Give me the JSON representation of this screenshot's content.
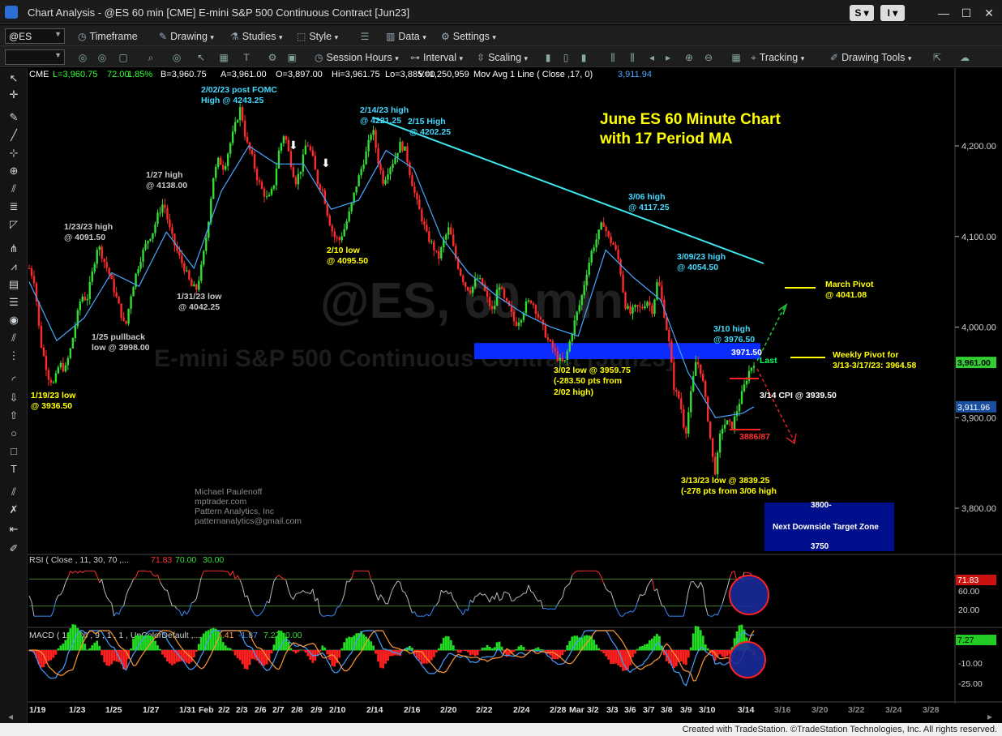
{
  "window": {
    "title": "Chart Analysis - @ES 60 min [CME] E-mini S&P 500 Continuous Contract [Jun23]",
    "btn_s": "S ▾",
    "btn_i": "I ▾",
    "minimize": "—",
    "maximize": "☐",
    "close": "✕"
  },
  "toolbar1": {
    "symbol": "@ES",
    "timeframe": "Timeframe",
    "drawing": "Drawing",
    "studies": "Studies",
    "style": "Style",
    "data": "Data",
    "settings": "Settings"
  },
  "toolbar2": {
    "session_hours": "Session Hours",
    "interval": "Interval",
    "scaling": "Scaling",
    "tracking": "Tracking",
    "drawing_tools": "Drawing Tools"
  },
  "status_bar": "Created with TradeStation. ©TradeStation Technologies, Inc. All rights reserved.",
  "chart_data": {
    "type": "line",
    "symbol_line": {
      "exchange": "CME",
      "last": "L=3,960.75",
      "net": "72.00",
      "pct": "1.85%",
      "bid": "B=3,960.75",
      "ask": "A=3,961.00",
      "open": "O=3,897.00",
      "high": "Hi=3,961.75",
      "low": "Lo=3,885.00",
      "volume": "V=1,250,959",
      "ma_label": "Mov Avg 1 Line ( Close ,17, 0)",
      "ma_value": "3,911.94"
    },
    "title": "June ES 60 Minute Chart",
    "subtitle": "with 17 Period MA",
    "watermark_symbol": "@ES, 60 min",
    "watermark_name": "E-mini S&P 500 Continuous Contract [Jun23]",
    "author_lines": [
      "Michael Paulenoff",
      "mptrader.com",
      "Pattern Analytics, Inc",
      "patternanalytics@gmail.com"
    ],
    "y_ticks": [
      "4,200.00",
      "4,100.00",
      "4,000.00",
      "3,900.00",
      "3,800.00"
    ],
    "y_tick_values": [
      4200,
      4100,
      4000,
      3900,
      3800
    ],
    "ylim": [
      3735,
      4270
    ],
    "x_ticks": [
      "1/19",
      "1/23",
      "1/25",
      "1/27",
      "1/31",
      "Feb",
      "2/2",
      "2/3",
      "2/6",
      "2/7",
      "2/8",
      "2/9",
      "2/10",
      "2/14",
      "2/16",
      "2/20",
      "2/22",
      "2/24",
      "2/28",
      "Mar",
      "3/2",
      "3/3",
      "3/6",
      "3/7",
      "3/8",
      "3/9",
      "3/10",
      "3/14",
      "3/16",
      "3/20",
      "3/22",
      "3/24",
      "3/28"
    ],
    "price_path": [
      [
        0,
        4065
      ],
      [
        2,
        4050
      ],
      [
        4,
        3985
      ],
      [
        7,
        3945
      ],
      [
        9,
        3937
      ],
      [
        11,
        3960
      ],
      [
        13,
        3952
      ],
      [
        15,
        3975
      ],
      [
        17,
        4005
      ],
      [
        19,
        4035
      ],
      [
        21,
        4030
      ],
      [
        23,
        4060
      ],
      [
        25,
        4092
      ],
      [
        27,
        4075
      ],
      [
        29,
        4060
      ],
      [
        31,
        4040
      ],
      [
        33,
        4020
      ],
      [
        35,
        3998
      ],
      [
        37,
        4035
      ],
      [
        39,
        4060
      ],
      [
        41,
        4080
      ],
      [
        43,
        4095
      ],
      [
        45,
        4105
      ],
      [
        47,
        4125
      ],
      [
        49,
        4138
      ],
      [
        51,
        4110
      ],
      [
        53,
        4090
      ],
      [
        55,
        4075
      ],
      [
        57,
        4062
      ],
      [
        59,
        4045
      ],
      [
        61,
        4042
      ],
      [
        63,
        4070
      ],
      [
        65,
        4110
      ],
      [
        67,
        4165
      ],
      [
        69,
        4185
      ],
      [
        71,
        4175
      ],
      [
        73,
        4200
      ],
      [
        75,
        4222
      ],
      [
        77,
        4243
      ],
      [
        79,
        4205
      ],
      [
        81,
        4190
      ],
      [
        83,
        4165
      ],
      [
        85,
        4150
      ],
      [
        87,
        4140
      ],
      [
        89,
        4155
      ],
      [
        91,
        4195
      ],
      [
        93,
        4215
      ],
      [
        95,
        4185
      ],
      [
        97,
        4160
      ],
      [
        99,
        4175
      ],
      [
        101,
        4205
      ],
      [
        103,
        4190
      ],
      [
        105,
        4160
      ],
      [
        107,
        4150
      ],
      [
        109,
        4120
      ],
      [
        111,
        4100
      ],
      [
        113,
        4096
      ],
      [
        115,
        4110
      ],
      [
        117,
        4130
      ],
      [
        119,
        4155
      ],
      [
        121,
        4175
      ],
      [
        123,
        4195
      ],
      [
        125,
        4221
      ],
      [
        127,
        4185
      ],
      [
        129,
        4160
      ],
      [
        131,
        4175
      ],
      [
        133,
        4185
      ],
      [
        135,
        4202
      ],
      [
        137,
        4195
      ],
      [
        139,
        4165
      ],
      [
        141,
        4140
      ],
      [
        143,
        4120
      ],
      [
        145,
        4100
      ],
      [
        147,
        4090
      ],
      [
        149,
        4075
      ],
      [
        151,
        4095
      ],
      [
        153,
        4110
      ],
      [
        155,
        4080
      ],
      [
        157,
        4060
      ],
      [
        159,
        4045
      ],
      [
        161,
        4040
      ],
      [
        163,
        4055
      ],
      [
        165,
        4048
      ],
      [
        167,
        4030
      ],
      [
        169,
        4015
      ],
      [
        171,
        4050
      ],
      [
        173,
        4030
      ],
      [
        175,
        4020
      ],
      [
        177,
        4003
      ],
      [
        179,
        4010
      ],
      [
        181,
        4025
      ],
      [
        183,
        4030
      ],
      [
        185,
        4015
      ],
      [
        187,
        4000
      ],
      [
        189,
        3985
      ],
      [
        191,
        3975
      ],
      [
        193,
        3963
      ],
      [
        195,
        3960
      ],
      [
        197,
        3985
      ],
      [
        199,
        4010
      ],
      [
        201,
        4030
      ],
      [
        203,
        4060
      ],
      [
        205,
        4085
      ],
      [
        207,
        4100
      ],
      [
        209,
        4117
      ],
      [
        211,
        4098
      ],
      [
        213,
        4090
      ],
      [
        215,
        4070
      ],
      [
        217,
        4025
      ],
      [
        219,
        4015
      ],
      [
        221,
        4022
      ],
      [
        223,
        4020
      ],
      [
        225,
        4030
      ],
      [
        227,
        4018
      ],
      [
        229,
        4054
      ],
      [
        231,
        4020
      ],
      [
        233,
        3985
      ],
      [
        235,
        3930
      ],
      [
        237,
        3920
      ],
      [
        239,
        3880
      ],
      [
        241,
        3925
      ],
      [
        243,
        3965
      ],
      [
        245,
        3948
      ],
      [
        247,
        3905
      ],
      [
        249,
        3855
      ],
      [
        250,
        3839
      ],
      [
        252,
        3888
      ],
      [
        254,
        3895
      ],
      [
        256,
        3890
      ],
      [
        258,
        3910
      ],
      [
        260,
        3930
      ],
      [
        262,
        3950
      ],
      [
        264,
        3961
      ]
    ],
    "ma_path": [
      [
        0,
        4050
      ],
      [
        10,
        3985
      ],
      [
        20,
        4010
      ],
      [
        30,
        4060
      ],
      [
        40,
        4045
      ],
      [
        50,
        4105
      ],
      [
        60,
        4065
      ],
      [
        70,
        4150
      ],
      [
        80,
        4200
      ],
      [
        90,
        4180
      ],
      [
        100,
        4180
      ],
      [
        110,
        4130
      ],
      [
        120,
        4140
      ],
      [
        130,
        4195
      ],
      [
        140,
        4175
      ],
      [
        150,
        4100
      ],
      [
        160,
        4060
      ],
      [
        170,
        4035
      ],
      [
        180,
        4015
      ],
      [
        190,
        4000
      ],
      [
        200,
        3990
      ],
      [
        210,
        4085
      ],
      [
        220,
        4055
      ],
      [
        230,
        4030
      ],
      [
        240,
        3950
      ],
      [
        250,
        3900
      ],
      [
        260,
        3905
      ],
      [
        264,
        3912
      ]
    ],
    "n_bars": 300,
    "annotations": [
      {
        "text": "2/02/23 post FOMC",
        "color": "#44d9ff"
      },
      {
        "text": "High @ 4243.25",
        "color": "#44d9ff"
      },
      {
        "text": "2/14/23 high",
        "color": "#44d9ff"
      },
      {
        "text": "@ 4221.25",
        "color": "#44d9ff"
      },
      {
        "text": "2/15 High",
        "color": "#44d9ff"
      },
      {
        "text": "@ 4202.25",
        "color": "#44d9ff"
      },
      {
        "text": "1/27 high",
        "color": "#c8c8c8"
      },
      {
        "text": "@ 4138.00",
        "color": "#c8c8c8"
      },
      {
        "text": "1/23/23 high",
        "color": "#c8c8c8"
      },
      {
        "text": "@ 4091.50",
        "color": "#c8c8c8"
      },
      {
        "text": "2/10 low",
        "color": "#ffff00"
      },
      {
        "text": "@ 4095.50",
        "color": "#ffff00"
      },
      {
        "text": "1/31/23 low",
        "color": "#c8c8c8"
      },
      {
        "text": "@ 4042.25",
        "color": "#c8c8c8"
      },
      {
        "text": "1/25 pullback",
        "color": "#c8c8c8"
      },
      {
        "text": "low @ 3998.00",
        "color": "#c8c8c8"
      },
      {
        "text": "1/19/23 low",
        "color": "#ffff00"
      },
      {
        "text": "@ 3936.50",
        "color": "#ffff00"
      },
      {
        "text": "3/06 high",
        "color": "#44d9ff"
      },
      {
        "text": "@ 4117.25",
        "color": "#44d9ff"
      },
      {
        "text": "3/09/23 high",
        "color": "#44d9ff"
      },
      {
        "text": "@ 4054.50",
        "color": "#44d9ff"
      },
      {
        "text": "3/10 high",
        "color": "#44d9ff"
      },
      {
        "text": "@ 3976.50",
        "color": "#44d9ff"
      },
      {
        "text": "3/02 low @ 3959.75",
        "color": "#ffff00"
      },
      {
        "text": "(-283.50 pts from",
        "color": "#ffff00"
      },
      {
        "text": "2/02 high)",
        "color": "#ffff00"
      },
      {
        "text": "3/13/23 low @ 3839.25",
        "color": "#ffff00"
      },
      {
        "text": "(-278 pts from 3/06 high",
        "color": "#ffff00"
      },
      {
        "text": "3/14 CPI @ 3939.50",
        "color": "#ffffff"
      },
      {
        "text": "March Pivot",
        "color": "#ffff00"
      },
      {
        "text": "@ 4041.08",
        "color": "#ffff00"
      },
      {
        "text": "Weekly Pivot for",
        "color": "#ffff00"
      },
      {
        "text": "3/13-3/17/23: 3964.58",
        "color": "#ffff00"
      },
      {
        "text": "3971.50",
        "color": "#ffffff"
      },
      {
        "text": "Last",
        "color": "#00ff66"
      },
      {
        "text": "3886/87",
        "color": "#ff3030"
      }
    ],
    "target_box": {
      "line1": "3800-",
      "line2": "Next Downside Target Zone",
      "line3": "3750"
    },
    "right_labels": {
      "last": "3,961.00",
      "ma": "3,911.96"
    },
    "resistance_zone": [
      3961,
      3977
    ],
    "march_pivot": 4041.08,
    "weekly_pivot": 3964.58,
    "rsi": {
      "label": "RSI ( Close , 11, 30, 70 ,...",
      "values": [
        "71.83",
        "70.00",
        "30.00"
      ],
      "value_colors": [
        "#ff3333",
        "#33dd33",
        "#33dd33"
      ],
      "ticks": [
        "71.83",
        "60.00",
        "20.00"
      ],
      "overbought": 70,
      "oversold": 30
    },
    "macd": {
      "label": "MACD ( 12 , 26 , 9 , 1 , 1 , UpColorDefault ,...",
      "values": [
        "5.41",
        "-1.87",
        "7.27",
        "0.00"
      ],
      "value_colors": [
        "#ff9933",
        "#4a9cff",
        "#33dd33",
        "#33dd33"
      ],
      "ticks": [
        "7.27",
        "-10.00",
        "-25.00"
      ]
    },
    "colors": {
      "up": "#33dd33",
      "down": "#ff2a2a",
      "ma": "#4aa6ff",
      "trendline": "#3ee6f0",
      "zone": "#0a2cff",
      "pivot": "#ffff00",
      "target_box": "#00108c"
    }
  }
}
